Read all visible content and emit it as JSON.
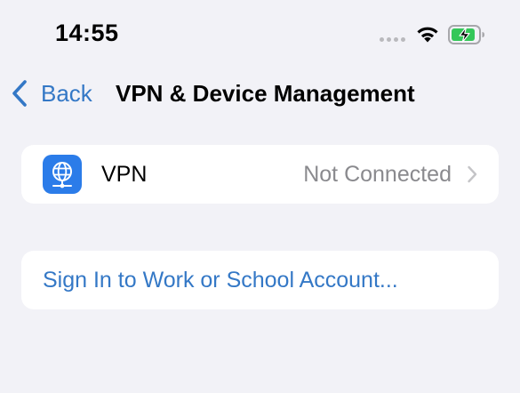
{
  "status_bar": {
    "time": "14:55",
    "icons": [
      "cellular-signal-icon",
      "wifi-icon",
      "battery-charging-icon"
    ]
  },
  "nav": {
    "back_label": "Back",
    "title": "VPN & Device Management"
  },
  "vpn_row": {
    "label": "VPN",
    "status": "Not Connected",
    "icon": "globe-network-icon"
  },
  "signin_row": {
    "label": "Sign In to Work or School Account..."
  },
  "colors": {
    "background": "#f2f2f7",
    "accent_blue": "#3478c6",
    "vpn_icon_blue": "#2b7ce9",
    "secondary_text": "#8a8a8e",
    "battery_green": "#34c759"
  }
}
